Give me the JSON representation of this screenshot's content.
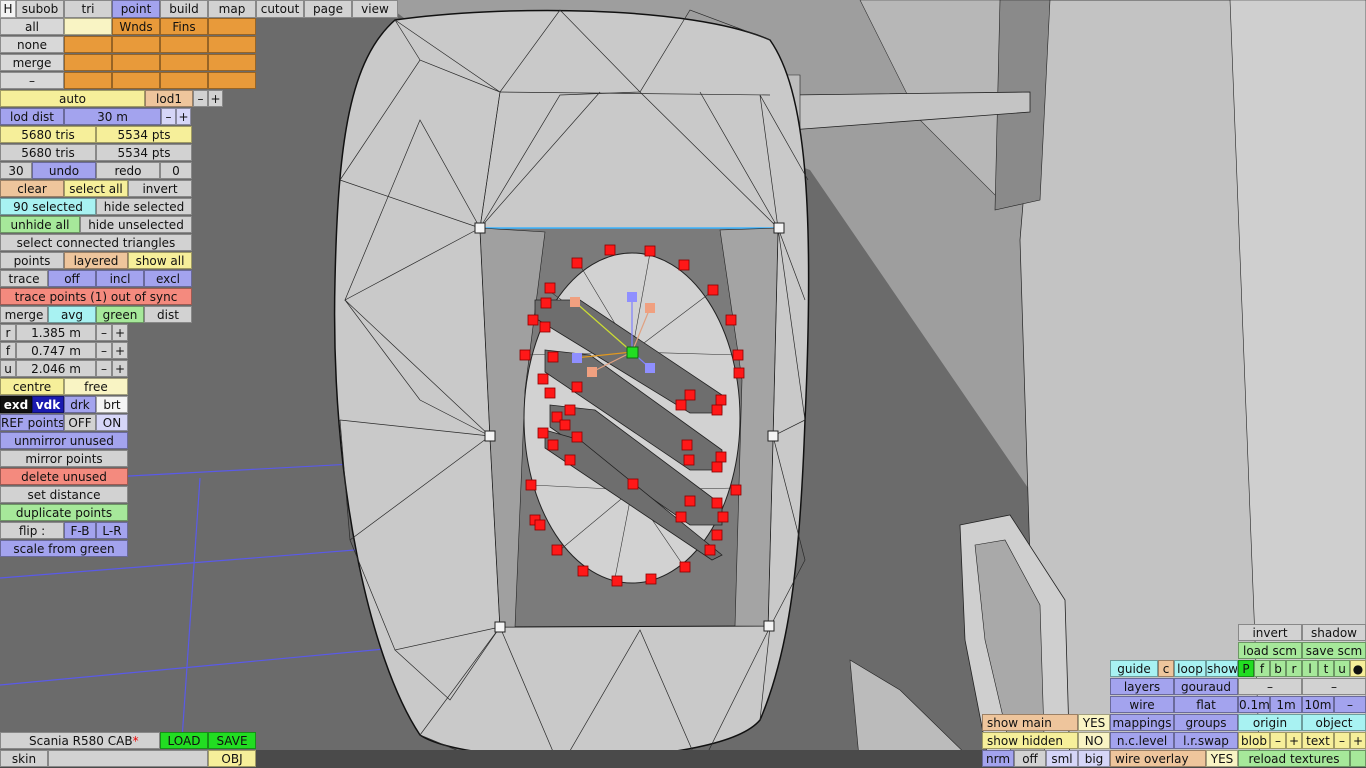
{
  "menubar": {
    "h_label": "H",
    "tabs": [
      "subob",
      "tri",
      "point",
      "build",
      "map",
      "cutout",
      "page",
      "view"
    ],
    "active_tab": "point"
  },
  "subobject_panel": {
    "column_headers": [
      "",
      "Wnds",
      "Fins",
      ""
    ],
    "rows": [
      "all",
      "none",
      "merge",
      "–"
    ]
  },
  "lod": {
    "mode": "auto",
    "level": "lod1",
    "minus": "–",
    "plus": "+",
    "dist_label": "lod dist",
    "dist_value": "30 m"
  },
  "stats": {
    "tris_1": "5680 tris",
    "pts_1": "5534 pts",
    "tris_2": "5680 tris",
    "pts_2": "5534 pts"
  },
  "history": {
    "count": "30",
    "undo": "undo",
    "redo": "redo",
    "redo_count": "0"
  },
  "selection": {
    "clear": "clear",
    "select_all": "select all",
    "invert": "invert",
    "selected": "90 selected",
    "hide_selected": "hide selected",
    "unhide_all": "unhide all",
    "hide_unselected": "hide unselected",
    "select_connected": "select connected triangles"
  },
  "points_row": {
    "points": "points",
    "layered": "layered",
    "show_all": "show all"
  },
  "trace": {
    "trace": "trace",
    "off": "off",
    "incl": "incl",
    "excl": "excl",
    "warning": "trace points (1) out of sync"
  },
  "merge_row": {
    "merge": "merge",
    "avg": "avg",
    "green": "green",
    "dist": "dist"
  },
  "coords": [
    {
      "axis": "r",
      "value": "1.385 m"
    },
    {
      "axis": "f",
      "value": "0.747 m"
    },
    {
      "axis": "u",
      "value": "2.046 m"
    }
  ],
  "pivot": {
    "centre": "centre",
    "free": "free"
  },
  "shade": {
    "exd": "exd",
    "vdk": "vdk",
    "drk": "drk",
    "brt": "brt"
  },
  "ref_points": {
    "label": "REF points",
    "off": "OFF",
    "on": "ON"
  },
  "point_tools": {
    "unmirror_unused": "unmirror unused",
    "mirror_points": "mirror points",
    "delete_unused": "delete unused",
    "set_distance": "set distance",
    "duplicate_points": "duplicate points",
    "flip_label": "flip :",
    "flip_fb": "F-B",
    "flip_lr": "L-R",
    "scale_from_green": "scale from green"
  },
  "model": {
    "name": "Scania R580 CAB",
    "modified_mark": "*",
    "load": "LOAD",
    "save": "SAVE",
    "skin_label": "skin",
    "skin_value": "",
    "obj": "OBJ"
  },
  "right_panel": {
    "invert": "invert",
    "shadow": "shadow",
    "load_scm": "load scm",
    "save_scm": "save scm",
    "guide": "guide",
    "c": "c",
    "loop": "loop",
    "show": "show",
    "axis_letters": [
      "P",
      "f",
      "b",
      "r",
      "l",
      "t",
      "u",
      "●"
    ],
    "layers": "layers",
    "gouraud": "gouraud",
    "dash_1": "–",
    "dash_2": "–",
    "wire": "wire",
    "flat": "flat",
    "grid_01": "0.1m",
    "grid_1": "1m",
    "grid_10": "10m",
    "grid_minus": "–",
    "show_main": "show main",
    "show_main_value": "YES",
    "mappings": "mappings",
    "groups": "groups",
    "origin": "origin",
    "object": "object",
    "show_hidden": "show hidden",
    "show_hidden_value": "NO",
    "nc_level": "n.c.level",
    "lr_swap": "l.r.swap",
    "blob": "blob",
    "blob_minus": "–",
    "blob_plus": "+",
    "text": "text",
    "text_minus": "–",
    "text_plus": "+",
    "nrm": "nrm",
    "off": "off",
    "sml": "sml",
    "big": "big",
    "wire_overlay": "wire overlay",
    "wire_overlay_value": "YES",
    "reload_textures": "reload textures"
  },
  "colors": {
    "background": "#686868",
    "mesh_fill": "#c9c9c9",
    "mesh_edge": "#222222",
    "selected_point": "#ff1818",
    "green_point": "#22dd22",
    "grid_line": "#5555ff"
  }
}
